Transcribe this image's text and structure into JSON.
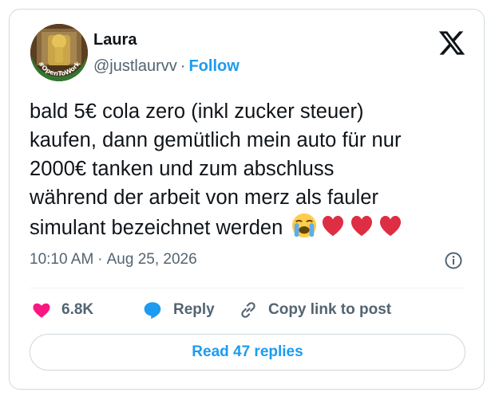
{
  "author": {
    "name": "Laura",
    "handle": "@justlaurvv",
    "separator": "·",
    "follow_label": "Follow",
    "avatar_badge": "#OpenToWork"
  },
  "tweet": {
    "lines": [
      "bald 5€ cola zero (inkl zucker steuer)",
      "kaufen, dann gemütlich mein auto für nur",
      "2000€ tanken und zum abschluss",
      "während der arbeit von merz als fauler",
      "simulant bezeichnet werden"
    ],
    "emojis": [
      "loudly-crying-face",
      "red-heart",
      "red-heart",
      "red-heart"
    ],
    "time": "10:10 AM",
    "separator": "·",
    "date": "Aug 25, 2026"
  },
  "actions": {
    "likes": "6.8K",
    "reply_label": "Reply",
    "copy_label": "Copy link to post"
  },
  "read_replies_label": "Read 47 replies",
  "colors": {
    "text": "#0f1419",
    "secondary": "#536471",
    "accent": "#1d9bf0",
    "like": "#f91880",
    "border": "#cfd9de",
    "avatar_badge_green": "#2e7d32"
  }
}
